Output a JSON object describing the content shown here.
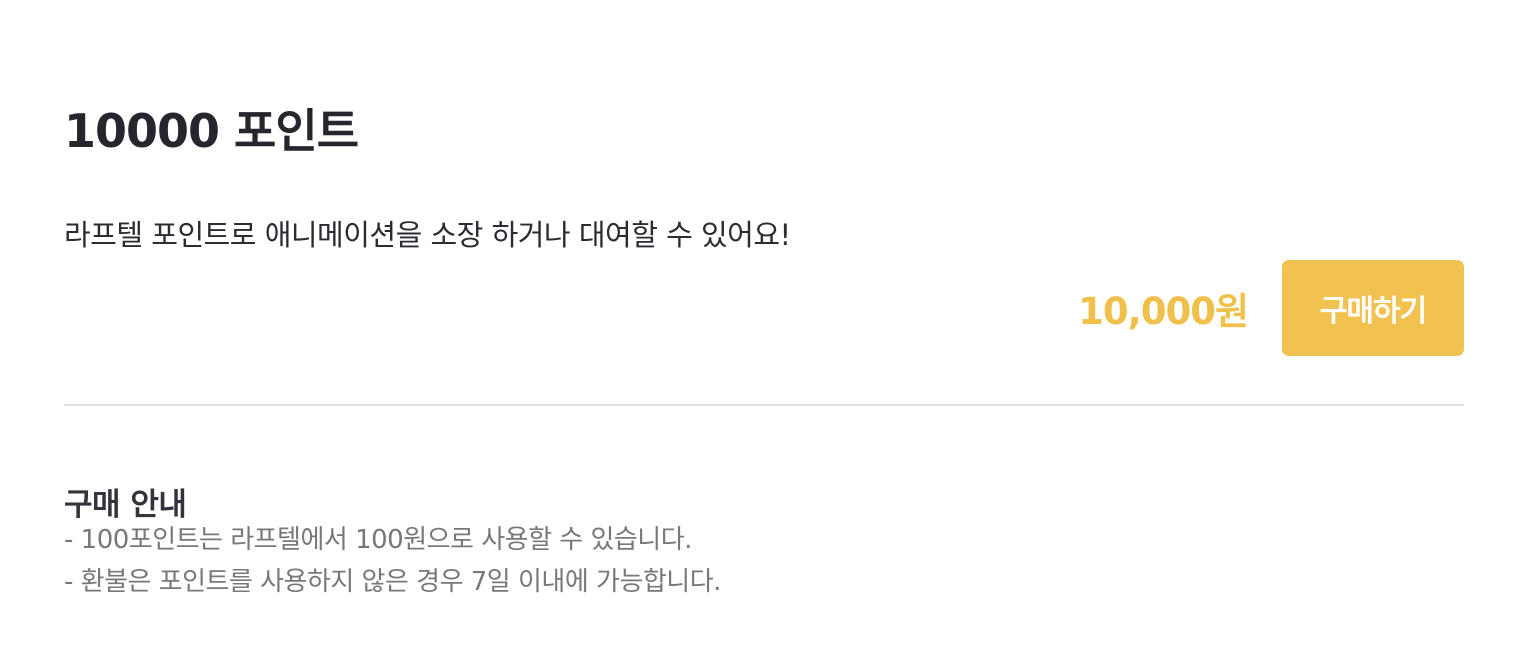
{
  "product": {
    "title": "10000 포인트",
    "description": "라프텔 포인트로 애니메이션을 소장 하거나 대여할 수 있어요!",
    "price": "10,000원",
    "buy_label": "구매하기"
  },
  "purchase_guide": {
    "title": "구매 안내",
    "notes": [
      "- 100포인트는 라프텔에서 100원으로 사용할 수 있습니다.",
      "- 환불은 포인트를 사용하지 않은 경우 7일 이내에 가능합니다."
    ]
  },
  "colors": {
    "accent": "#f1c24f",
    "price_text": "#f0c04b",
    "divider": "#e2e2e2",
    "muted_text": "#77777d"
  }
}
